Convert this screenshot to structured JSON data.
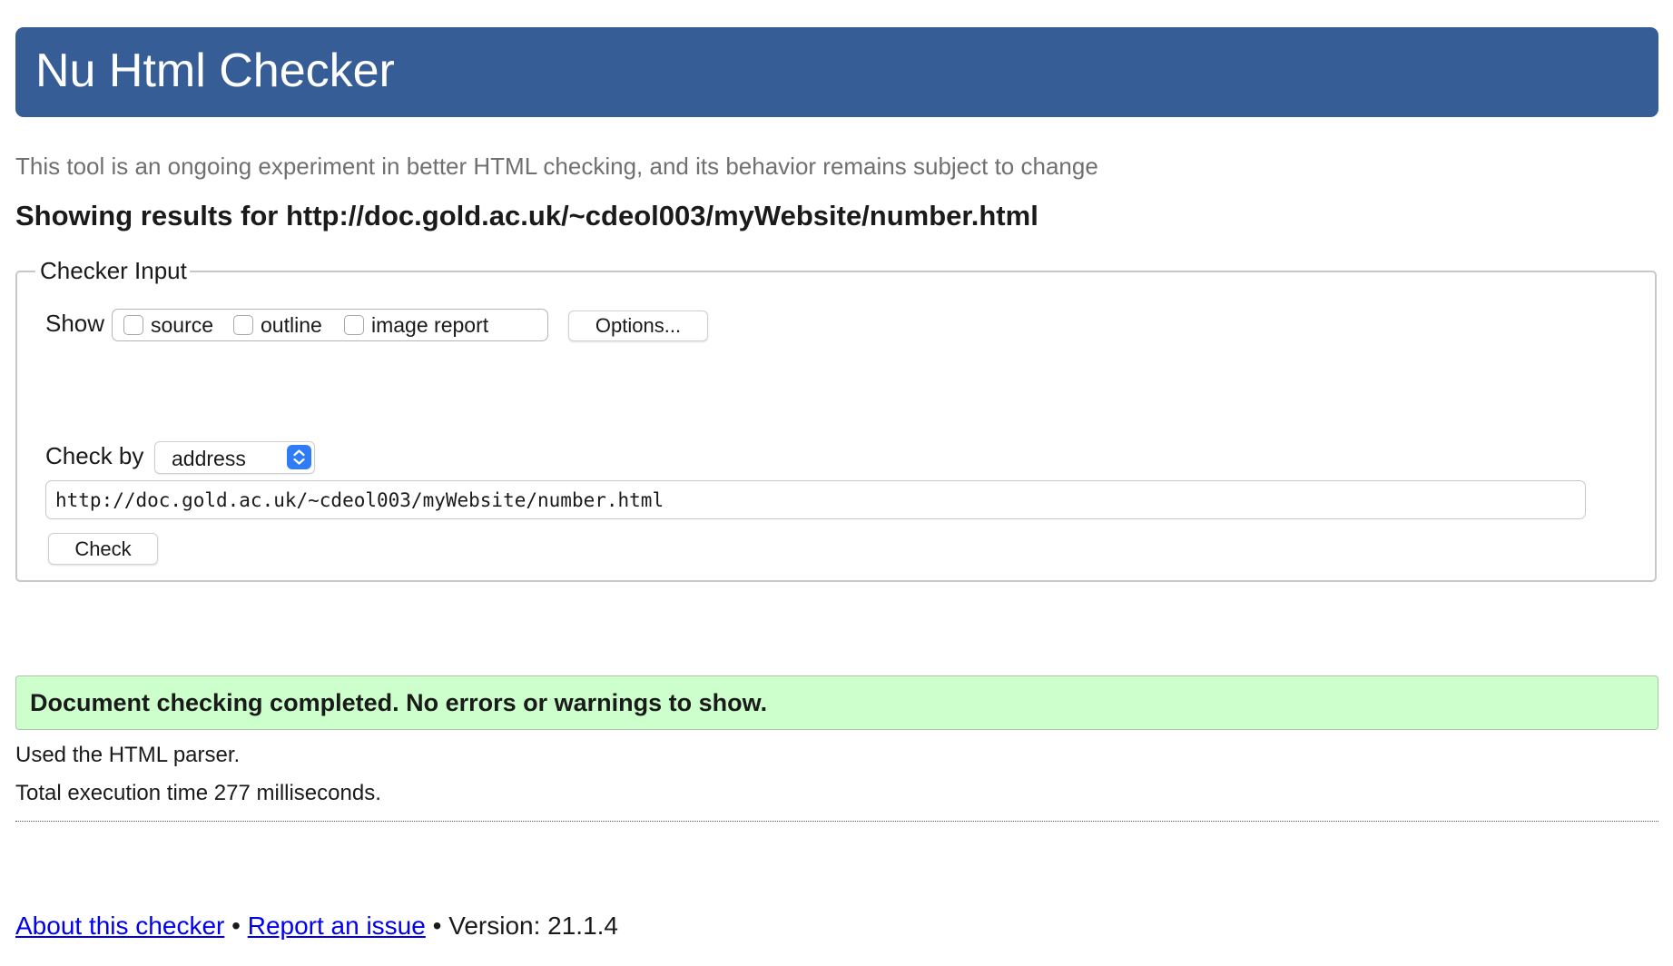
{
  "header": {
    "title": "Nu Html Checker"
  },
  "tagline": "This tool is an ongoing experiment in better HTML checking, and its behavior remains subject to change",
  "results_heading": "Showing results for http://doc.gold.ac.uk/~cdeol003/myWebsite/number.html",
  "checker_input": {
    "legend": "Checker Input",
    "show_label": "Show",
    "show_options": [
      {
        "label": "source",
        "checked": false
      },
      {
        "label": "outline",
        "checked": false
      },
      {
        "label": "image report",
        "checked": false
      }
    ],
    "options_button": "Options...",
    "check_by_label": "Check by",
    "check_by_value": "address",
    "url_value": "http://doc.gold.ac.uk/~cdeol003/myWebsite/number.html",
    "check_button": "Check"
  },
  "result": {
    "message": "Document checking completed. No errors or warnings to show.",
    "parser_info": "Used the HTML parser.",
    "execution_time": "Total execution time 277 milliseconds."
  },
  "footer": {
    "about_link": "About this checker",
    "separator": "•",
    "report_link": "Report an issue",
    "version": "Version: 21.1.4"
  },
  "colors": {
    "header_bg": "#365d95",
    "success_bg": "#ccffcc",
    "link": "#0000ee",
    "select_accent": "#2f7cf6"
  },
  "icons": {
    "select_arrow": "chevron-up-down-icon"
  }
}
